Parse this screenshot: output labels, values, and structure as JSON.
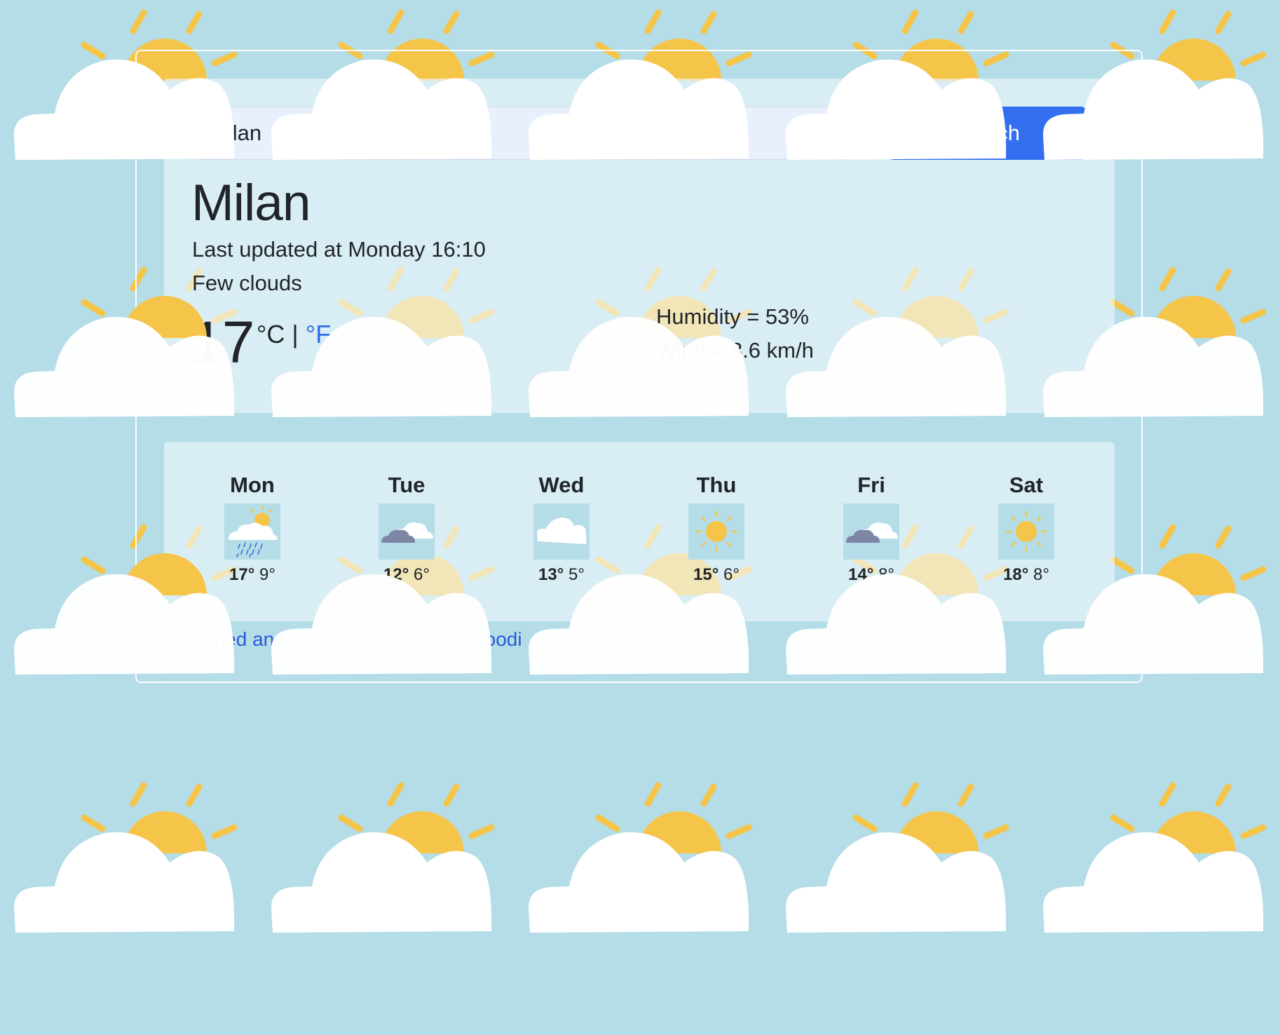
{
  "search": {
    "value": "milan",
    "button_label": "search"
  },
  "current": {
    "city": "Milan",
    "updated_text": "Last updated at Monday 16:10",
    "description": "Few clouds",
    "temperature": "17",
    "unit_celsius": "°C",
    "unit_separator": "|",
    "unit_fahrenheit": "°F",
    "humidity_text": "Humidity = 53%",
    "wind_text": "Wind = 3.6 km/h"
  },
  "forecast": [
    {
      "day": "Mon",
      "icon": "rain-partly-sunny-icon",
      "high": "17°",
      "low": "9°"
    },
    {
      "day": "Tue",
      "icon": "broken-clouds-icon",
      "high": "12°",
      "low": "6°"
    },
    {
      "day": "Wed",
      "icon": "overcast-cloud-icon",
      "high": "13°",
      "low": "5°"
    },
    {
      "day": "Thu",
      "icon": "sun-icon",
      "high": "15°",
      "low": "6°"
    },
    {
      "day": "Fri",
      "icon": "broken-clouds-icon",
      "high": "14°",
      "low": "8°"
    },
    {
      "day": "Sat",
      "icon": "sun-icon",
      "high": "18°",
      "low": "8°"
    }
  ],
  "footer": {
    "prefix": "Designed and",
    "link": "coded",
    "suffix": "by Hasti Maghsoodi"
  },
  "colors": {
    "background": "#b4dde7",
    "accent_button": "#346ff0",
    "link": "#2a5bd7",
    "sun": "#f5c54a",
    "cloud": "#ffffff"
  }
}
